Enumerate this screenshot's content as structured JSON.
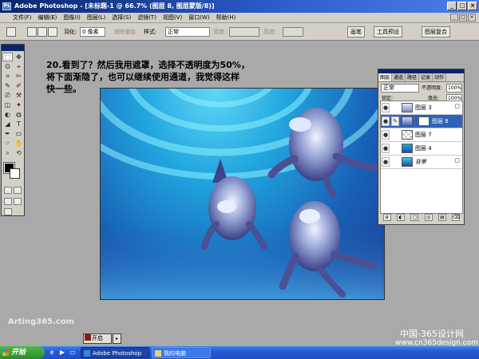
{
  "window": {
    "title": "Adobe Photoshop - [未标题-1 @ 66.7% (图层 8, 图层蒙版/8)]",
    "app_icon": "Ps",
    "controls": [
      "_",
      "□",
      "×"
    ]
  },
  "menubar": {
    "items": [
      "文件(F)",
      "编辑(E)",
      "图像(I)",
      "图层(L)",
      "选择(S)",
      "滤镜(T)",
      "视图(V)",
      "窗口(W)",
      "帮助(H)"
    ],
    "doc_controls": [
      "_",
      "□",
      "×"
    ]
  },
  "options_bar": {
    "feather_label": "羽化:",
    "feather_value": "0 像素",
    "antialias_label": "消除锯齿",
    "style_label": "样式:",
    "style_value": "正常",
    "width_label": "宽度:",
    "height_label": "高度:",
    "wells": [
      "画笔",
      "工具预设",
      "图层复合"
    ]
  },
  "toolbox": {
    "tools": [
      "⬚",
      "✥",
      "ʘ",
      "⌖",
      "⌗",
      "✄",
      "✎",
      "✐",
      "⎚",
      "⚒",
      "◫",
      "✦",
      "◐",
      "◍",
      "◢",
      "T",
      "✒",
      "▭",
      "☞",
      "✋",
      "⌕",
      "⟲"
    ],
    "foreground_color": "#000000",
    "background_color": "#ffffff"
  },
  "tutorial": {
    "line1": "20.看到了？然后我用遮罩，选择不透明度为50%，",
    "line2": "将下面渐隐了，也可以继续使用通道，我觉得这样",
    "line3": "快一些。"
  },
  "layers_panel": {
    "tabs": [
      "图层",
      "通道",
      "路径",
      "记录",
      "动作"
    ],
    "blend_mode": "正常",
    "opacity_label": "不透明度:",
    "opacity_value": "100%",
    "lock_label": "锁定:",
    "fill_label": "填充:",
    "fill_value": "100%",
    "layers": [
      {
        "name": "图层 3",
        "selected": false
      },
      {
        "name": "图层 8",
        "selected": true
      },
      {
        "name": "图层 7",
        "selected": false
      },
      {
        "name": "图层 4",
        "selected": false
      },
      {
        "name": "背景",
        "selected": false
      }
    ],
    "footer_buttons": [
      "ø",
      "◐",
      "□",
      "◎",
      "▤",
      "⌫"
    ]
  },
  "watermarks": {
    "left": "Arting365.com",
    "right_cn": "中国-365设计网",
    "right_url": "www.cn365design.com"
  },
  "status": {
    "button_label": "开启"
  },
  "taskbar": {
    "start_label": "开始",
    "tasks": [
      "Adobe Photoshop -...",
      "我的电脑"
    ]
  },
  "colors": {
    "titlebar": "#0a246a",
    "selected_layer": "#2e63b9",
    "workspace": "#a9a9a9"
  }
}
